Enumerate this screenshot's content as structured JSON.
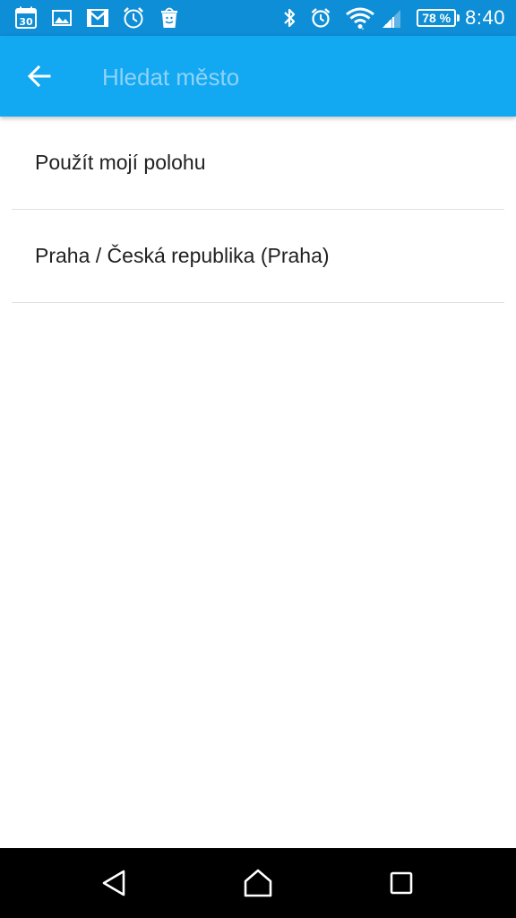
{
  "status_bar": {
    "notification_icons": [
      "calendar-icon",
      "gallery-icon",
      "gmail-icon",
      "clock-app-icon",
      "android-store-icon"
    ],
    "calendar_day": "30",
    "system_icons": [
      "bluetooth-icon",
      "alarm-icon",
      "wifi-icon",
      "signal-icon"
    ],
    "battery_text": "78 %",
    "battery_level": 0.78,
    "time": "8:40",
    "colors": {
      "background": "#0d8ed6"
    }
  },
  "app_bar": {
    "back_icon": "arrow-left-icon",
    "search_placeholder": "Hledat město",
    "search_value": "",
    "colors": {
      "background": "#12a8f2",
      "placeholder": "#8fd3f8"
    }
  },
  "results": [
    {
      "label": "Použít mojí polohu"
    },
    {
      "label": "Praha / Česká republika (Praha)"
    }
  ],
  "nav_bar": {
    "buttons": [
      "back-triangle-icon",
      "home-icon",
      "recents-icon"
    ]
  }
}
